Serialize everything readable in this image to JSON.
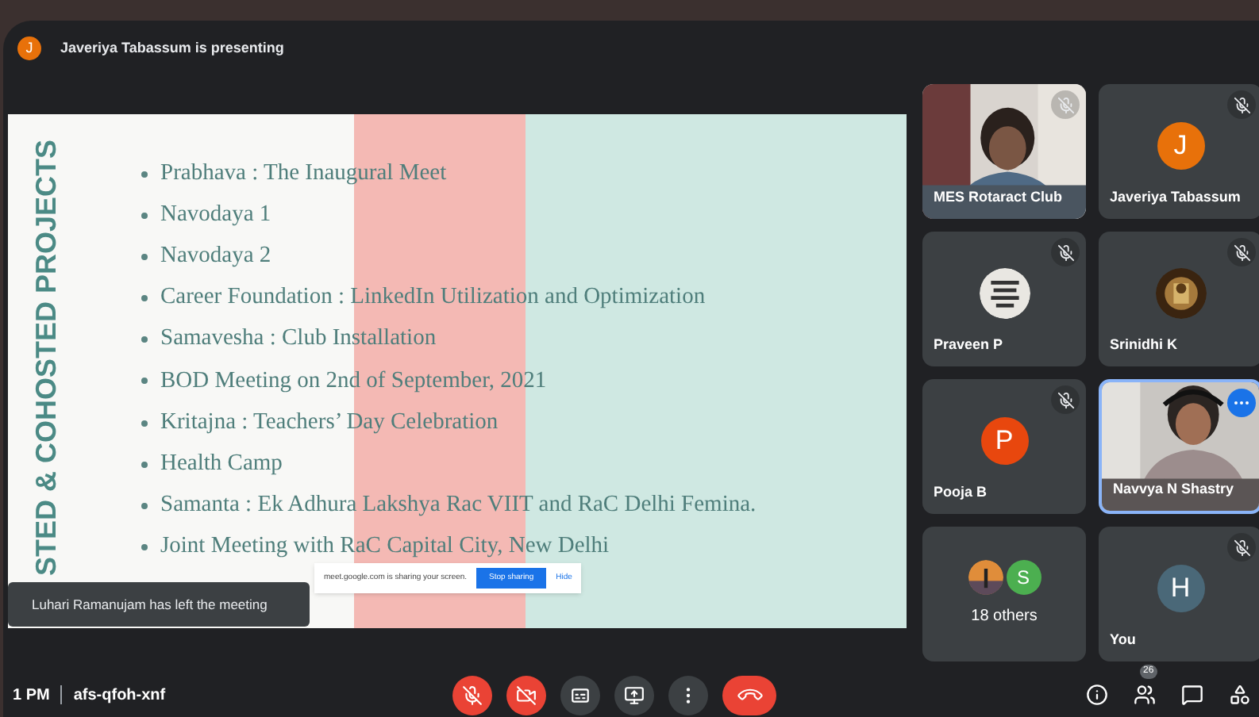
{
  "presenter_banner": {
    "avatar_letter": "J",
    "text": "Javeriya Tabassum is presenting"
  },
  "slide": {
    "side_title": "STED & COHOSTED PROJECTS",
    "bullets": [
      "Prabhava : The Inaugural Meet",
      "Navodaya 1",
      "Navodaya 2",
      "Career Foundation : LinkedIn Utilization and Optimization",
      "Samavesha : Club Installation",
      "BOD Meeting on 2nd of September, 2021",
      "Kritajna : Teachers’ Day Celebration",
      "Health Camp",
      "Samanta : Ek Adhura Lakshya Rac VIIT and RaC Delhi Femina.",
      "Joint Meeting with RaC Capital City, New Delhi"
    ]
  },
  "share_bar": {
    "message": "meet.google.com is sharing your screen.",
    "stop_button": "Stop sharing",
    "hide_link": "Hide"
  },
  "toast": "Luhari Ramanujam has left the meeting",
  "tiles": [
    {
      "kind": "video",
      "name": "MES Rotaract Club",
      "muted": true,
      "speaking": false
    },
    {
      "kind": "letter",
      "name": "Javeriya Tabassum",
      "letter": "J",
      "color": "#e8710a",
      "muted": true,
      "speaking": false
    },
    {
      "name": "Praveen P",
      "muted": true,
      "speaking": false
    },
    {
      "name": "Srinidhi K",
      "muted": true,
      "speaking": false
    },
    {
      "kind": "letter",
      "name": "Pooja B",
      "letter": "P",
      "color": "#e8470e",
      "muted": true,
      "speaking": false
    },
    {
      "kind": "video",
      "name": "Navvya N Shastry",
      "muted": false,
      "speaking": true
    },
    {
      "kind": "others",
      "name": "18 others",
      "letter": "S",
      "color": "#4caf50",
      "muted": false,
      "speaking": false
    },
    {
      "kind": "letter",
      "name": "You",
      "letter": "H",
      "color": "#4a6878",
      "muted": true,
      "speaking": false
    }
  ],
  "bottom_bar": {
    "time": "1 PM",
    "meeting_code": "afs-qfoh-xnf",
    "controls": [
      {
        "kind": "mic",
        "on": false
      },
      {
        "kind": "camera",
        "on": false
      },
      {
        "kind": "captions"
      },
      {
        "kind": "present"
      },
      {
        "kind": "more"
      },
      {
        "kind": "leave"
      }
    ],
    "side_buttons": [
      {
        "kind": "info"
      },
      {
        "kind": "people",
        "badge": "26"
      },
      {
        "kind": "chat"
      },
      {
        "kind": "activities"
      }
    ]
  }
}
